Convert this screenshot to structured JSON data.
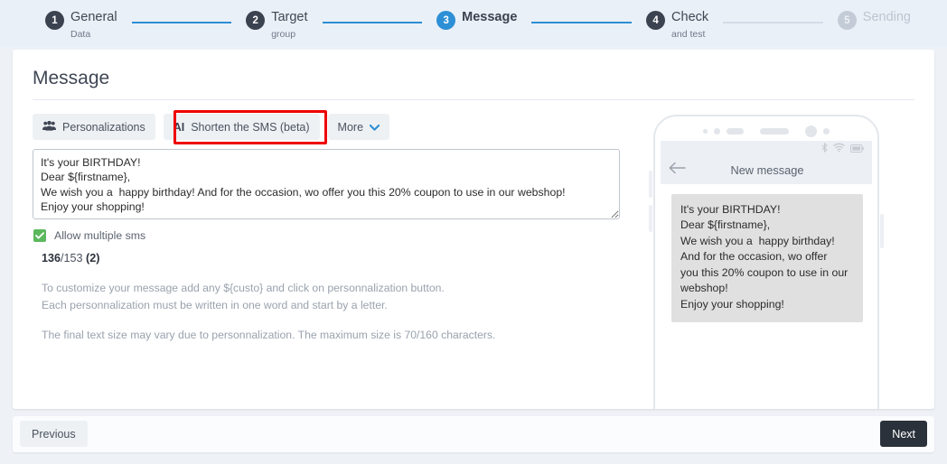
{
  "stepper": {
    "steps": [
      {
        "num": "1",
        "title": "General",
        "sub": "Data",
        "state": "done"
      },
      {
        "num": "2",
        "title": "Target",
        "sub": "group",
        "state": "done"
      },
      {
        "num": "3",
        "title": "Message",
        "sub": "",
        "state": "active"
      },
      {
        "num": "4",
        "title": "Check",
        "sub": "and test",
        "state": "done"
      },
      {
        "num": "5",
        "title": "Sending",
        "sub": "",
        "state": "disabled"
      }
    ]
  },
  "card": {
    "title": "Message",
    "toolbar": {
      "personalizations_label": "Personalizations",
      "ai_tag": "AI",
      "ai_shorten_label": "Shorten the SMS (beta)",
      "more_label": "More",
      "people_icon": "people-icon",
      "chevron_icon": "chevron-down-icon",
      "highlight_color": "#ee0000"
    },
    "message": {
      "text": "It's your BIRTHDAY!\nDear ${firstname},\nWe wish you a  happy birthday! And for the occasion, wo offer you this 20% coupon to use in our webshop!\nEnjoy your shopping!"
    },
    "allow_multiple": {
      "label": "Allow multiple sms",
      "checked": true,
      "check_color": "#5cb85c"
    },
    "counter": {
      "used": "136",
      "separator": "/",
      "total": "153",
      "parts": "(2)"
    },
    "help": {
      "line1": "To customize your message add any ${custo} and click on personnalization button.",
      "line2": "Each personnalization must be written in one word and start by a letter.",
      "line3": "The final text size may vary due to personnalization. The maximum size is 70/160 characters."
    },
    "phone": {
      "screen_title": "New message",
      "back_icon": "back-arrow-icon",
      "status_icons": [
        "bluetooth-icon",
        "wifi-icon",
        "battery-icon"
      ],
      "bubble_text": "It's your BIRTHDAY!\nDear ${firstname},\nWe wish you a  happy birthday!\nAnd for the occasion, wo offer\nyou this 20% coupon to use in our\nwebshop!\nEnjoy your shopping!"
    }
  },
  "footer": {
    "previous_label": "Previous",
    "next_label": "Next",
    "next_bg": "#2b313b"
  }
}
